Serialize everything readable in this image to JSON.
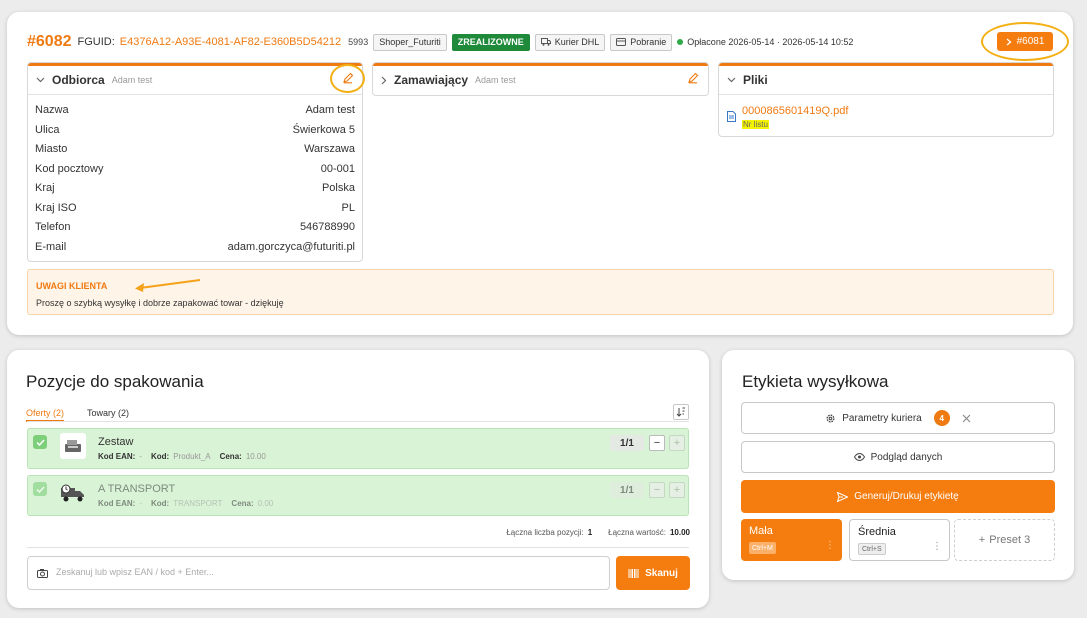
{
  "order": {
    "id": "#6082",
    "fguid_label": "FGUID:",
    "fguid": "E4376A12-A93E-4081-AF82-E360B5D54212",
    "number": "5993",
    "shop": "Shoper_Futuriti",
    "status": "ZREALIZOWNE",
    "courier": "Kurier DHL",
    "payment": "Pobranie",
    "paid_text": "Opłacone 2026-05-14 · 2026-05-14 10:52",
    "next_order": "#6081"
  },
  "recipient": {
    "title": "Odbiorca",
    "subtitle": "Adam test",
    "rows": [
      {
        "label": "Nazwa",
        "value": "Adam test"
      },
      {
        "label": "Ulica",
        "value": "Świerkowa 5"
      },
      {
        "label": "Miasto",
        "value": "Warszawa"
      },
      {
        "label": "Kod pocztowy",
        "value": "00-001"
      },
      {
        "label": "Kraj",
        "value": "Polska"
      },
      {
        "label": "Kraj ISO",
        "value": "PL"
      },
      {
        "label": "Telefon",
        "value": "546788990"
      },
      {
        "label": "E-mail",
        "value": "adam.gorczyca@futuriti.pl"
      }
    ]
  },
  "orderer": {
    "title": "Zamawiający",
    "subtitle": "Adam test"
  },
  "files": {
    "title": "Pliki",
    "file_name": "0000865601419Q.pdf",
    "file_tag": "Nr listu"
  },
  "notes": {
    "title": "UWAGI KLIENTA",
    "text": "Proszę o szybką wysyłkę i dobrze zapakować towar - dziękuję"
  },
  "packing": {
    "title": "Pozycje do spakowania",
    "tabs": [
      "Oferty (2)",
      "Towary (2)"
    ],
    "items": [
      {
        "name": "Zestaw",
        "ean_label": "Kod EAN:",
        "ean": "-",
        "code_label": "Kod:",
        "code": "Produkt_A",
        "price_label": "Cena:",
        "price": "10.00",
        "count": "1/1",
        "minus": "−",
        "plus": "+"
      },
      {
        "name": "A TRANSPORT",
        "ean_label": "Kod EAN:",
        "ean": "-",
        "code_label": "Kod:",
        "code": "TRANSPORT",
        "price_label": "Cena:",
        "price": "0.00",
        "count": "1/1",
        "minus": "−",
        "plus": "+"
      }
    ],
    "total_items_label": "Łączna liczba pozycji:",
    "total_items": "1",
    "total_value_label": "Łączna wartość:",
    "total_value": "10.00",
    "scan_placeholder": "Zeskanuj lub wpisz EAN / kod + Enter...",
    "scan_button": "Skanuj"
  },
  "label": {
    "title": "Etykieta wysyłkowa",
    "courier_params": "Parametry kuriera",
    "courier_params_count": "4",
    "preview": "Podgląd danych",
    "generate": "Generuj/Drukuj etykietę",
    "presets": [
      {
        "name": "Mała",
        "key": "Ctrl+M"
      },
      {
        "name": "Średnia",
        "key": "Ctrl+S"
      },
      {
        "name": "Preset 3"
      }
    ]
  },
  "colors": {
    "accent": "#f57c0f",
    "status_green": "#1f8a3a",
    "item_bg": "#d9f3d6",
    "highlight_ring": "#f3b015"
  }
}
